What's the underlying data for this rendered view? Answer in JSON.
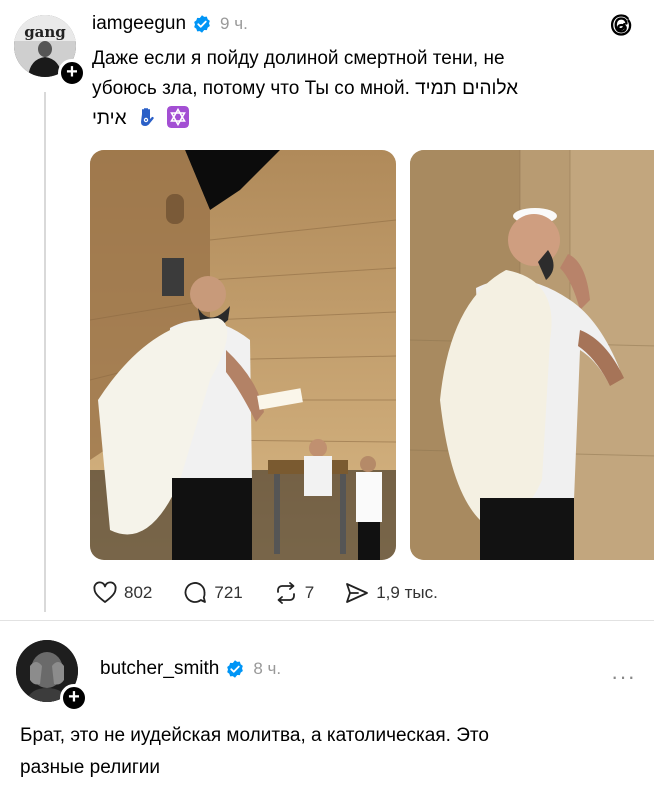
{
  "post": {
    "username": "iamgeegun",
    "time": "9 ч.",
    "avatar_logo_text": "gang",
    "text_line1": "Даже если я пойду долиной смертной тени, не",
    "text_line2": "убоюсь зла, потому что Ты со мной. אלוהים תמיד",
    "text_line3": "איתי",
    "emoji": [
      "hamsa-emoji",
      "star-of-david-emoji"
    ],
    "actions": {
      "likes": "802",
      "comments": "721",
      "reposts": "7",
      "shares": "1,9 тыс."
    }
  },
  "reply": {
    "username": "butcher_smith",
    "time": "8 ч.",
    "more": "···",
    "text_line1": "Брат, это не иудейская молитва, а католическая. Это",
    "text_line2": "разные религии"
  },
  "colors": {
    "verified": "#0095f6",
    "muted": "#999999",
    "star_box": "#a34fd3"
  }
}
